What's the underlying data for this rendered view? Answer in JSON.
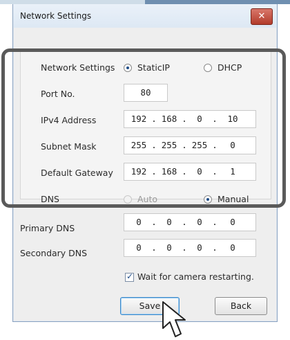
{
  "window": {
    "title": "Network Settings",
    "close_label": "✕"
  },
  "settings": {
    "network_settings": {
      "label": "Network Settings",
      "options": [
        "StaticIP",
        "DHCP"
      ],
      "selected": "StaticIP"
    },
    "port": {
      "label": "Port No.",
      "value": "80"
    },
    "ipv4": {
      "label": "IPv4 Address",
      "parts": [
        "192",
        "168",
        "0",
        "10"
      ]
    },
    "subnet": {
      "label": "Subnet Mask",
      "parts": [
        "255",
        "255",
        "255",
        "0"
      ]
    },
    "gateway": {
      "label": "Default Gateway",
      "parts": [
        "192",
        "168",
        "0",
        "1"
      ]
    },
    "dns": {
      "label": "DNS",
      "options": [
        "Auto",
        "Manual"
      ],
      "selected": "Manual"
    },
    "primary_dns": {
      "label": "Primary DNS",
      "parts": [
        "0",
        "0",
        "0",
        "0"
      ]
    },
    "secondary_dns": {
      "label": "Secondary DNS",
      "parts": [
        "0",
        "0",
        "0",
        "0"
      ]
    }
  },
  "wait_checkbox": {
    "label": "Wait for camera restarting.",
    "checked": true
  },
  "buttons": {
    "save": "Save",
    "back": "Back"
  },
  "ip_dot": ".",
  "icons": {
    "close": "close-icon",
    "cursor": "mouse-pointer-icon",
    "check": "checkmark-icon"
  },
  "colors": {
    "title_bar": "#dde8f4",
    "close_button": "#c0443a",
    "highlight_frame": "#5a5a5a",
    "focus": "#3b87c8"
  }
}
